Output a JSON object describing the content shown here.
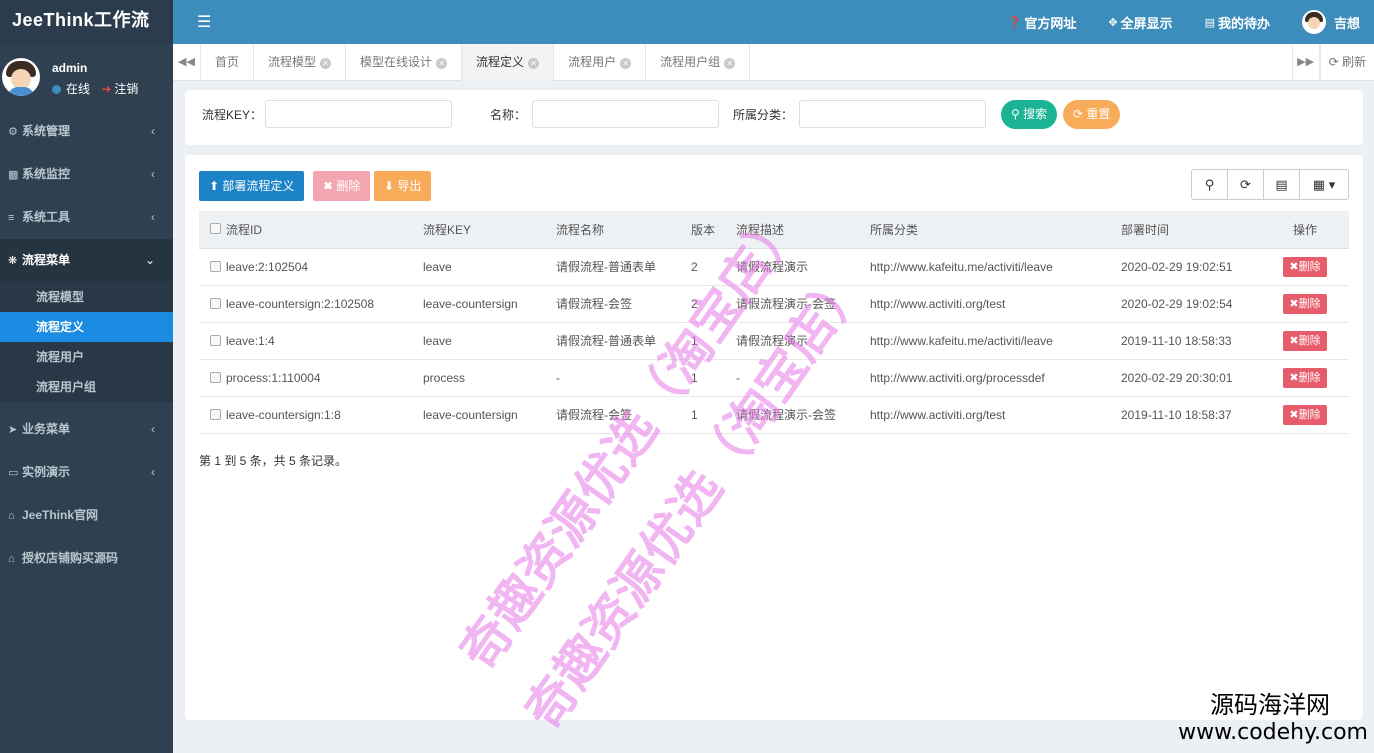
{
  "brand": "JeeThink工作流",
  "user": {
    "name": "admin",
    "status": "在线",
    "logout": "注销"
  },
  "sidebar": {
    "items": [
      {
        "label": "系统管理",
        "icon": "gear-icon"
      },
      {
        "label": "系统监控",
        "icon": "video-icon"
      },
      {
        "label": "系统工具",
        "icon": "bars-icon"
      },
      {
        "label": "流程菜单",
        "icon": "cogs-icon"
      }
    ],
    "subitems": [
      "流程模型",
      "流程定义",
      "流程用户",
      "流程用户组"
    ],
    "items_after": [
      {
        "label": "业务菜单",
        "icon": "paper-plane-icon"
      },
      {
        "label": "实例演示",
        "icon": "desktop-icon"
      },
      {
        "label": "JeeThink官网",
        "icon": "home-icon"
      },
      {
        "label": "授权店铺购买源码",
        "icon": "home-icon"
      }
    ]
  },
  "header": {
    "official_site": "官方网址",
    "fullscreen": "全屏显示",
    "todo": "我的待办",
    "username": "吉想"
  },
  "tabs": [
    "首页",
    "流程模型",
    "模型在线设计",
    "流程定义",
    "流程用户",
    "流程用户组"
  ],
  "tab_refresh": "刷新",
  "search": {
    "key_label": "流程KEY：",
    "name_label": "名称：",
    "category_label": "所属分类：",
    "search_btn": "搜索",
    "reset_btn": "重置"
  },
  "toolbar": {
    "deploy": "部署流程定义",
    "delete": "删除",
    "export": "导出"
  },
  "table": {
    "headers": [
      "流程ID",
      "流程KEY",
      "流程名称",
      "版本",
      "流程描述",
      "所属分类",
      "部署时间",
      "操作"
    ],
    "rows": [
      [
        "leave:2:102504",
        "leave",
        "请假流程-普通表单",
        "2",
        "请假流程演示",
        "http://www.kafeitu.me/activiti/leave",
        "2020-02-29 19:02:51"
      ],
      [
        "leave-countersign:2:102508",
        "leave-countersign",
        "请假流程-会签",
        "2",
        "请假流程演示-会签",
        "http://www.activiti.org/test",
        "2020-02-29 19:02:54"
      ],
      [
        "leave:1:4",
        "leave",
        "请假流程-普通表单",
        "1",
        "请假流程演示",
        "http://www.kafeitu.me/activiti/leave",
        "2019-11-10 18:58:33"
      ],
      [
        "process:1:110004",
        "process",
        "-",
        "1",
        "-",
        "http://www.activiti.org/processdef",
        "2020-02-29 20:30:01"
      ],
      [
        "leave-countersign:1:8",
        "leave-countersign",
        "请假流程-会签",
        "1",
        "请假流程演示-会签",
        "http://www.activiti.org/test",
        "2019-11-10 18:58:37"
      ]
    ],
    "row_action": "删除"
  },
  "pagination_summary": "第 1 到 5 条，共 5 条记录。",
  "watermark": "奇趣资源优选（淘宝店）",
  "site_mark": {
    "line1": "源码海洋网",
    "line2": "www.codehy.com"
  }
}
